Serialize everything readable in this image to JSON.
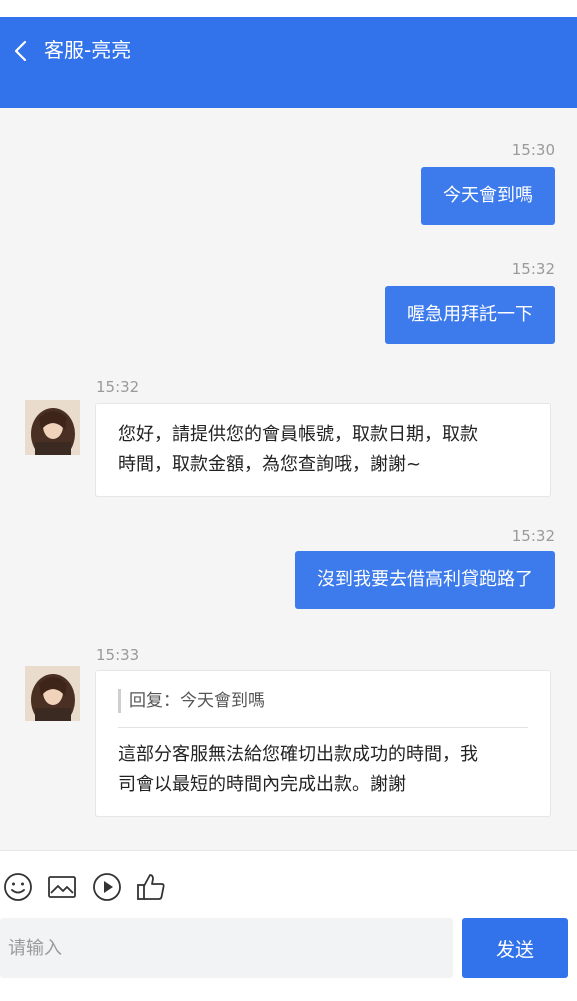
{
  "header": {
    "title": "客服-亮亮"
  },
  "messages": [
    {
      "time": "15:30",
      "text": "今天會到嗎"
    },
    {
      "time": "15:32",
      "text": "喔急用拜託一下"
    },
    {
      "time": "15:32",
      "lines": [
        "您好，請提供您的會員帳號，取款日期，取款",
        "時間，取款金額，為您查詢哦，謝謝~"
      ]
    },
    {
      "time": "15:32",
      "text": "沒到我要去借高利貸跑路了"
    },
    {
      "time": "15:33",
      "quote": "回复：今天會到嗎",
      "lines": [
        "這部分客服無法給您確切出款成功的時間，我",
        "司會以最短的時間內完成出款。謝謝"
      ]
    }
  ],
  "toolbar": {
    "icons": [
      "smiley-icon",
      "image-icon",
      "video-play-icon",
      "thumbs-up-icon"
    ],
    "input_placeholder": "请输入",
    "send_label": "发送"
  },
  "colors": {
    "primary": "#3272ea",
    "bubble_out": "#3d7bec",
    "background": "#f5f5f5"
  }
}
